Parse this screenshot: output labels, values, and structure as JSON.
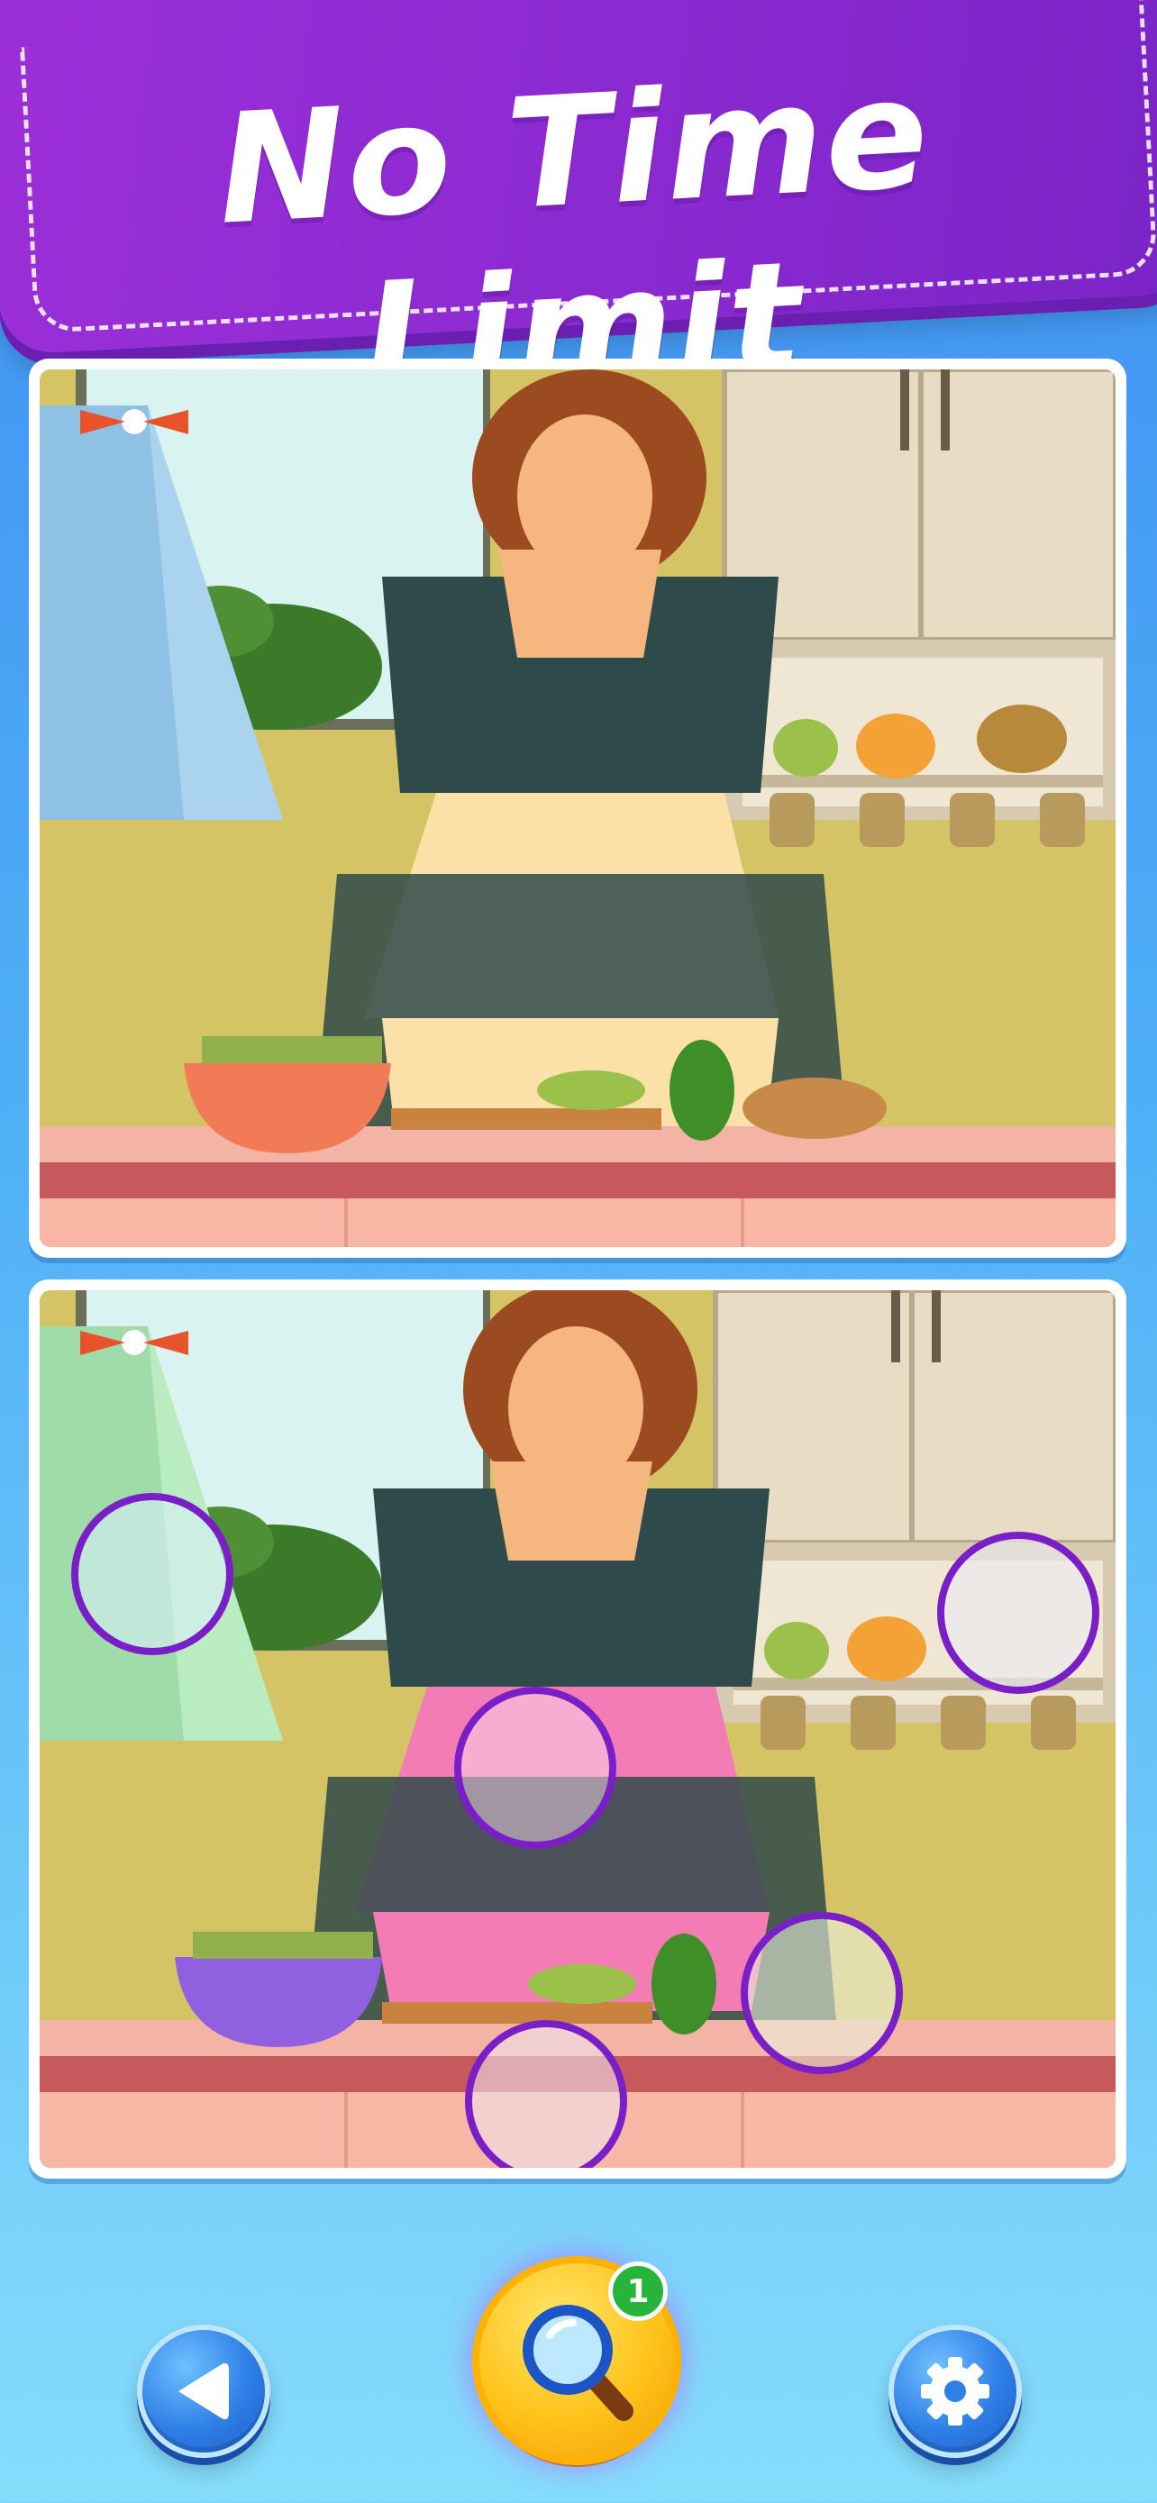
{
  "banner": {
    "title": "No Time Limit"
  },
  "hint": {
    "count": "1"
  },
  "differences": {
    "found": 5
  },
  "colors": {
    "banner": "#8a2ad0",
    "found_ring": "#7a1fc8",
    "hint_button": "#ffc21a",
    "nav_button": "#2e7fe6"
  },
  "icons": {
    "back": "back-arrow-icon",
    "hint": "magnifier-icon",
    "settings": "gear-icon"
  }
}
